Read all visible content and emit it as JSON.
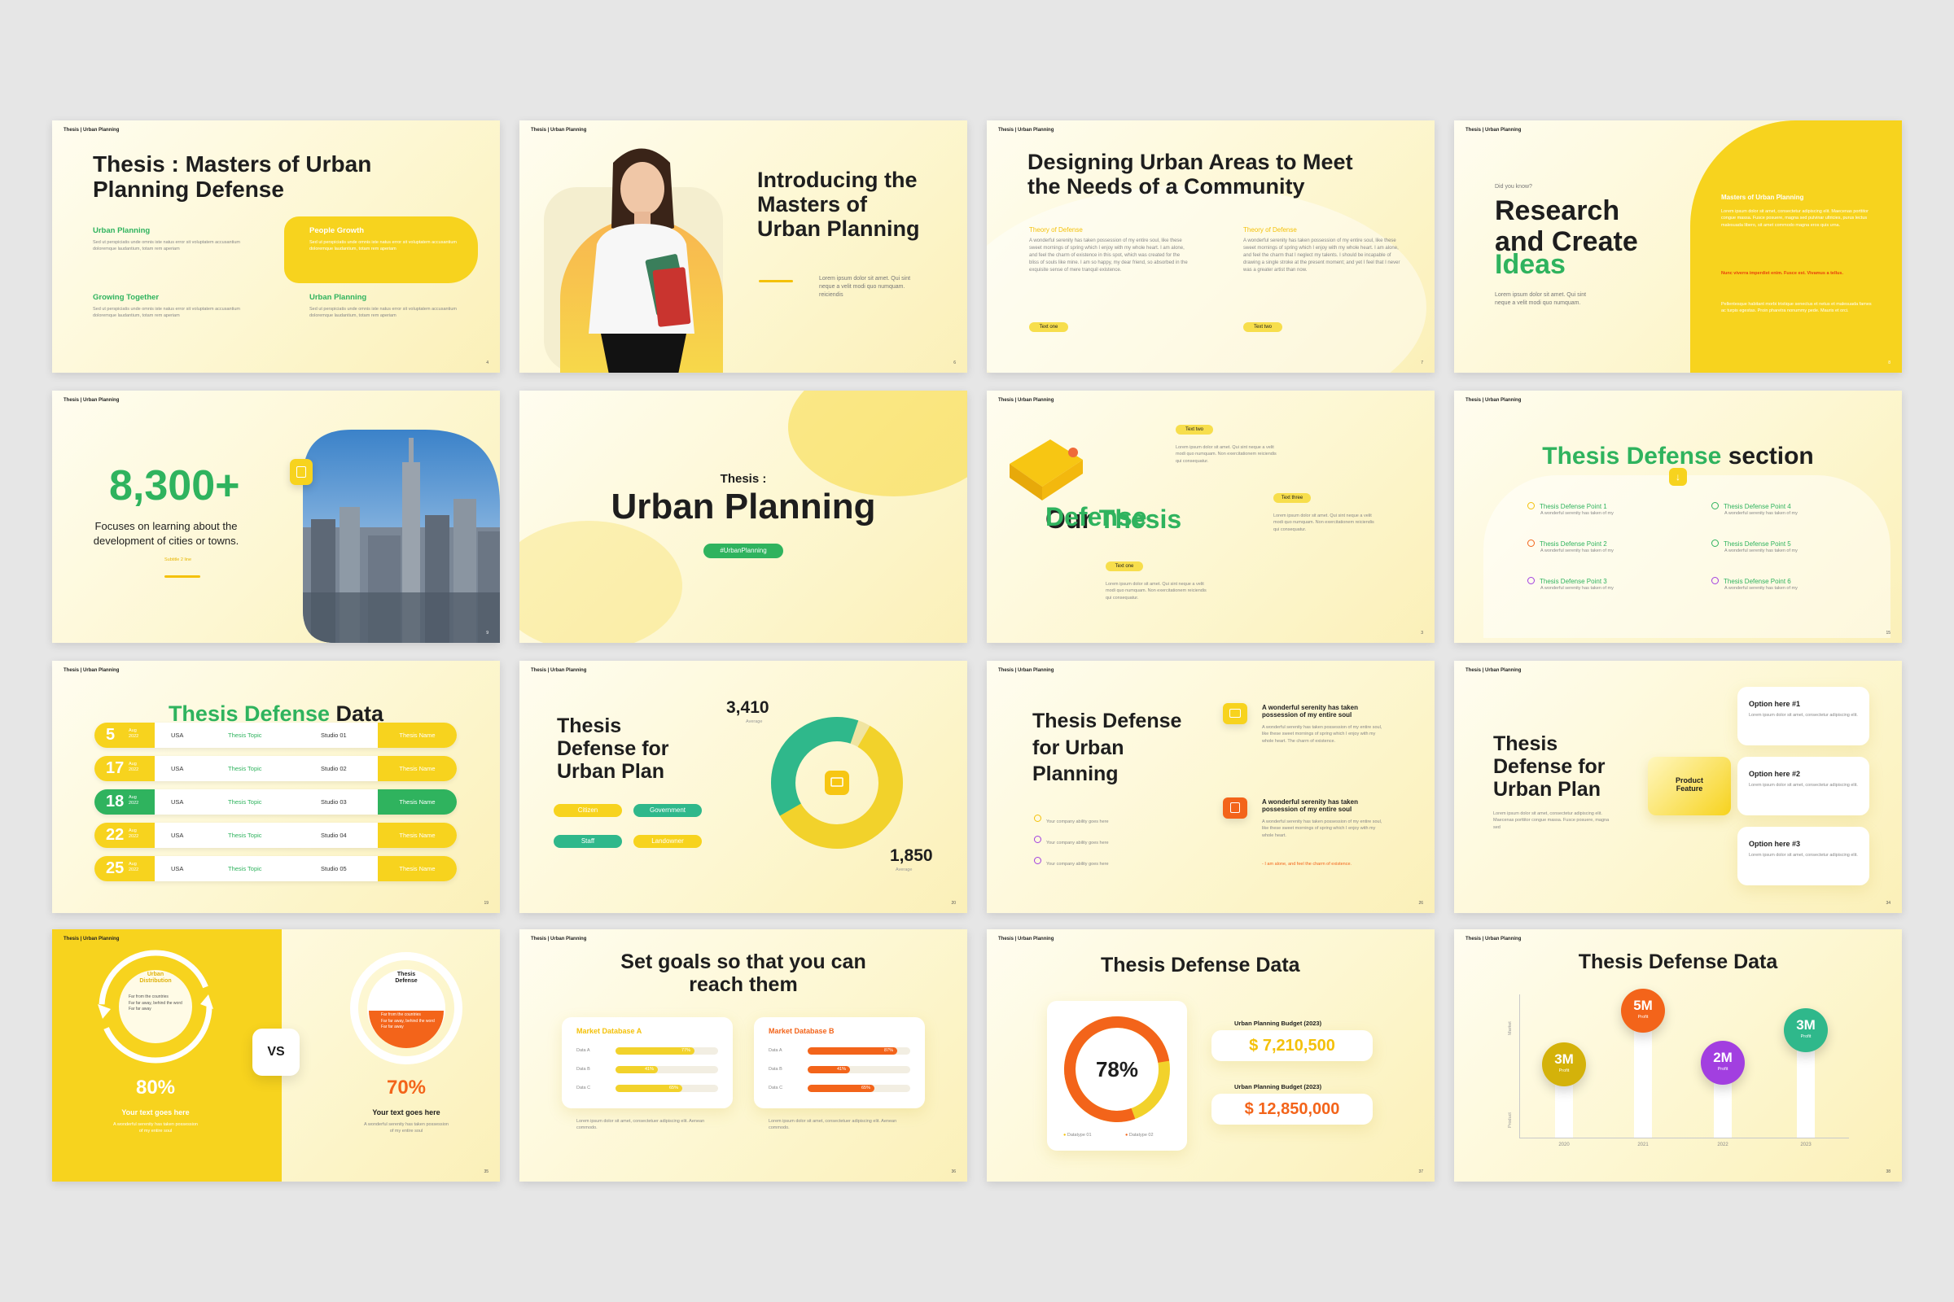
{
  "brand": "Thesis | Urban Planning",
  "colors": {
    "yellow": "#f4c10a",
    "green": "#2fb35e",
    "orange": "#f3641a",
    "purple": "#a23fe0",
    "teal": "#2fb88b"
  },
  "slides": {
    "s1": {
      "title": "Thesis : Masters of Urban\nPlanning Defense",
      "items": [
        {
          "label": "Urban Planning",
          "text": "Sed ut perspiciatis unde omnis iste natus error sit voluptatem accusantium doloremque laudantium, totam rem aperiam"
        },
        {
          "label": "People Growth",
          "text": "Sed ut perspiciatis unde omnis iste natus error sit voluptatem accusantium doloremque laudantium, totam rem aperiam"
        },
        {
          "label": "Growing Together",
          "text": "Sed ut perspiciatis unde omnis iste natus error sit voluptatem accusantium doloremque laudantium, totam rem aperiam"
        },
        {
          "label": "Urban Planning",
          "text": "Sed ut perspiciatis unde omnis iste natus error sit voluptatem accusantium doloremque laudantium, totam rem aperiam"
        }
      ],
      "num": "4"
    },
    "s2": {
      "title": "Introducing the\nMasters of\nUrban Planning",
      "text": "Lorem ipsum dolor sit amet. Qui sint neque a velit modi quo numquam. reiciendis",
      "num": "6"
    },
    "s3": {
      "title": "Designing Urban Areas to Meet\nthe Needs of a Community",
      "col1": {
        "label": "Theory of Defense",
        "text": "A wonderful serenity has taken possession of my entire soul, like these sweet mornings of spring which I enjoy with my whole heart. I am alone, and feel the charm of existence in this spot, which was created for the bliss of souls like mine. I am so happy, my dear friend, so absorbed in the exquisite sense of mere tranquil existence.",
        "tag": "Text one"
      },
      "col2": {
        "label": "Theory of Defense",
        "text": "A wonderful serenity has taken possession of my entire soul, like these sweet mornings of spring which I enjoy with my whole heart. I am alone, and feel the charm that I neglect my talents. I should be incapable of drawing a single stroke at the present moment; and yet I feel that I never was a greater artist than now.",
        "tag": "Text two"
      },
      "num": "7"
    },
    "s4": {
      "kicker": "Did you know?",
      "title1": "Research\nand Create",
      "title2": "Ideas",
      "text": "Lorem ipsum dolor sit amet. Qui sint neque a velit modi quo numquam.",
      "panel_label": "Masters of Urban Planning",
      "panel_text1": "Lorem ipsum dolor sit amet, consectetur adipiscing elit. Maecenas porttitor congue massa. Fusce posuere, magna sed pulvinar ultricies, purus lectus malesuada libero, sit amet commodo magna eros quis urna.",
      "panel_text2": "Nunc viverra imperdiet enim. Fusce est. Vivamus a tellus.",
      "panel_text3": "Pellentesque habitant morbi tristique senectus et netus et malesuada fames ac turpis egestas. Proin pharetra nonummy pede. Mauris et orci.",
      "num": "8"
    },
    "s5": {
      "stat": "8,300+",
      "text": "Focuses on learning about the\ndevelopment of cities or towns.",
      "sub": "Subtitle 2 line",
      "num": "9"
    },
    "s6": {
      "kicker": "Thesis :",
      "title": "Urban Planning",
      "tag": "#UrbanPlanning"
    },
    "s7": {
      "title1": "Our ",
      "title2": "Thesis",
      "title3": "Defense",
      "tags": [
        {
          "tag": "Text two",
          "text": "Lorem ipsum dolor sit amet. Qui sint neque a velit modi quo numquam. Non exercitationem reiciendis qui consequatur."
        },
        {
          "tag": "Text three",
          "text": "Lorem ipsum dolor sit amet. Qui sint neque a velit modi quo numquam. Non exercitationem reiciendis qui consequatur."
        },
        {
          "tag": "Text one",
          "text": "Lorem ipsum dolor sit amet. Qui sint neque a velit modi quo numquam. Non exercitationem reiciendis qui consequatur."
        }
      ],
      "num": "3"
    },
    "s8": {
      "title1": "Thesis Defense",
      "title2": " section",
      "points": [
        {
          "label": "Thesis Defense Point 1",
          "text": "A wonderful serenity has taken of my",
          "color": "#f4c10a"
        },
        {
          "label": "Thesis Defense Point 2",
          "text": "A wonderful serenity has taken of my",
          "color": "#f3641a"
        },
        {
          "label": "Thesis Defense Point 3",
          "text": "A wonderful serenity has taken of my",
          "color": "#a23fe0"
        },
        {
          "label": "Thesis Defense Point 4",
          "text": "A wonderful serenity has taken of my",
          "color": "#2fb35e"
        },
        {
          "label": "Thesis Defense Point 5",
          "text": "A wonderful serenity has taken of my",
          "color": "#2fb35e"
        },
        {
          "label": "Thesis Defense Point 6",
          "text": "A wonderful serenity has taken of my",
          "color": "#a23fe0"
        }
      ],
      "num": "15"
    },
    "s9": {
      "title1": "Thesis Defense",
      "title2": " Data",
      "rows": [
        {
          "day": "5",
          "mo": "Aug\n2022",
          "country": "USA",
          "topic": "Thesis Topic",
          "studio": "Studio 01",
          "name": "Thesis Name",
          "hl": false
        },
        {
          "day": "17",
          "mo": "Aug\n2022",
          "country": "USA",
          "topic": "Thesis Topic",
          "studio": "Studio 02",
          "name": "Thesis Name",
          "hl": false
        },
        {
          "day": "18",
          "mo": "Aug\n2022",
          "country": "USA",
          "topic": "Thesis Topic",
          "studio": "Studio 03",
          "name": "Thesis Name",
          "hl": true
        },
        {
          "day": "22",
          "mo": "Aug\n2022",
          "country": "USA",
          "topic": "Thesis Topic",
          "studio": "Studio 04",
          "name": "Thesis Name",
          "hl": false
        },
        {
          "day": "25",
          "mo": "Aug\n2022",
          "country": "USA",
          "topic": "Thesis Topic",
          "studio": "Studio 05",
          "name": "Thesis Name",
          "hl": false
        }
      ],
      "num": "19"
    },
    "s10": {
      "title": "Thesis\nDefense for\nUrban Plan",
      "v1": "3,410",
      "v1sub": "Average",
      "v2": "1,850",
      "v2sub": "Average",
      "pills": [
        "Citizen",
        "Government",
        "Staff",
        "Landowner"
      ],
      "num": "20"
    },
    "s11": {
      "title": "Thesis Defense\nfor Urban\nPlanning",
      "checks": [
        "Your company ability goes here",
        "Your company ability goes here",
        "Your company ability goes here"
      ],
      "b1title": "A wonderful serenity has taken\npossession of my entire soul",
      "b1text": "A wonderful serenity has taken possession of my entire soul, like these sweet mornings of spring which I enjoy with my whole heart. The charm of existence.",
      "b2title": "A wonderful serenity has taken\npossession of my entire soul",
      "b2text": "A wonderful serenity has taken possession of my entire soul, like these sweet mornings of spring which I enjoy with my whole heart.",
      "b2note": "- I am alone, and feel the charm of existence.",
      "num": "26"
    },
    "s12": {
      "title": "Thesis\nDefense for\nUrban Plan",
      "text": "Lorem ipsum dolor sit amet, consectetur adipiscing elit. Maecenas porttitor congue massa. Fusce posuere, magna sed",
      "center": "Product\nFeature",
      "options": [
        {
          "label": "Option here #1",
          "text": "Lorem ipsum dolor sit amet, consectetur adipiscing elit."
        },
        {
          "label": "Option here #2",
          "text": "Lorem ipsum dolor sit amet, consectetur adipiscing elit."
        },
        {
          "label": "Option here #3",
          "text": "Lorem ipsum dolor sit amet, consectetur adipiscing elit."
        }
      ],
      "num": "34"
    },
    "s13": {
      "left_label": "Urban\nDistribution",
      "left_list": [
        "Far from the countries",
        "Far far away, behind the word",
        "Far far away"
      ],
      "right_label": "Thesis\nDefense",
      "right_list": [
        "Far from the countries",
        "Far far away, behind the word",
        "Far far away"
      ],
      "vs": "VS",
      "p1": "80%",
      "p1title": "Your text goes here",
      "p1text": "A wonderful serenity has taken possession of my entire soul",
      "p2": "70%",
      "p2title": "Your text goes here",
      "p2text": "A wonderful serenity has taken possession of my entire soul",
      "num": "35"
    },
    "s14": {
      "title": "Set goals so that you can\nreach them",
      "dbA": {
        "label": "Market Database A",
        "rows": [
          {
            "name": "Data A",
            "pct": "77%",
            "v": 0.77
          },
          {
            "name": "Data B",
            "pct": "41%",
            "v": 0.41
          },
          {
            "name": "Data C",
            "pct": "65%",
            "v": 0.65
          }
        ],
        "text": "Lorem ipsum dolor sit amet, consectetuer adipiscing elit. Aenean commodo."
      },
      "dbB": {
        "label": "Market Database B",
        "rows": [
          {
            "name": "Data A",
            "pct": "87%",
            "v": 0.87
          },
          {
            "name": "Data B",
            "pct": "41%",
            "v": 0.41
          },
          {
            "name": "Data C",
            "pct": "65%",
            "v": 0.65
          }
        ],
        "text": "Lorem ipsum dolor sit amet, consectetuer adipiscing elit. Aenean commodo."
      },
      "num": "36"
    },
    "s15": {
      "title": "Thesis Defense Data",
      "donut": "78%",
      "legend": [
        "Datatype 01",
        "Datatype 02"
      ],
      "b1label": "Urban Planning Budget (2023)",
      "b1": "$ 7,210,500",
      "b2label": "Urban Planning Budget (2023)",
      "b2": "$ 12,850,000",
      "num": "37"
    },
    "s16": {
      "title": "Thesis Defense Data",
      "yaxis1": "Market",
      "yaxis2": "Product",
      "bubbles": [
        {
          "value": "3M",
          "sub": "Profit",
          "year": "2020",
          "color": "#d4b20a"
        },
        {
          "value": "5M",
          "sub": "Profit",
          "year": "2021",
          "color": "#f3641a"
        },
        {
          "value": "2M",
          "sub": "Profit",
          "year": "2022",
          "color": "#a23fe0"
        },
        {
          "value": "3M",
          "sub": "Profit",
          "year": "2023",
          "color": "#2fb88b"
        }
      ],
      "num": "38"
    }
  }
}
